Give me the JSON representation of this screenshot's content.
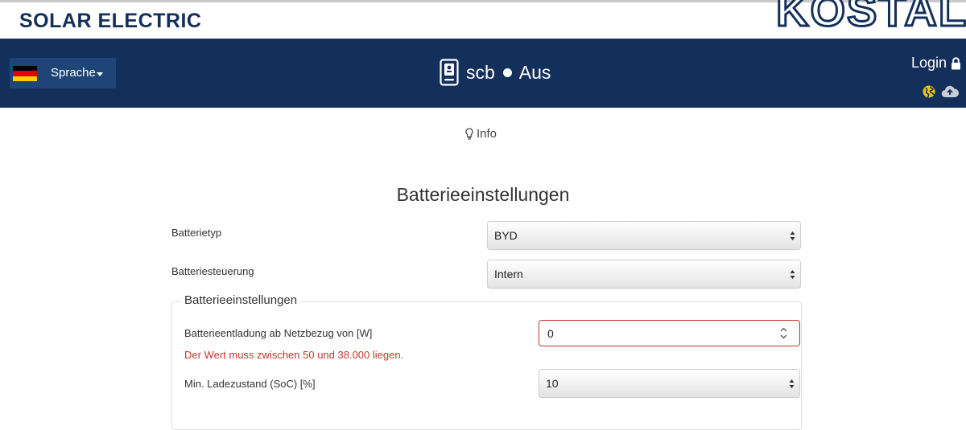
{
  "brand": {
    "title": "SOLAR ELECTRIC",
    "logo_text": "KOSTAL"
  },
  "navbar": {
    "language_label": "Sprache",
    "device_name": "scb",
    "device_state": "Aus",
    "login_label": "Login"
  },
  "info": {
    "label": "Info"
  },
  "page": {
    "title": "Batterieeinstellungen"
  },
  "form": {
    "battery_type": {
      "label": "Batterietyp",
      "value": "BYD"
    },
    "battery_control": {
      "label": "Batteriesteuerung",
      "value": "Intern"
    },
    "group": {
      "legend": "Batterieeinstellungen",
      "discharge": {
        "label": "Batterieentladung ab Netzbezug von [W]",
        "value": "0",
        "error": "Der Wert muss zwischen 50 und 38.000 liegen."
      },
      "min_soc": {
        "label": "Min. Ladezustand (SoC) [%]",
        "value": "10"
      }
    }
  },
  "colors": {
    "navbar": "#13305c",
    "brand_text": "#14305a",
    "error": "#c0392b",
    "globe_accent": "#f0c800"
  },
  "icons": [
    "flag-germany-icon",
    "caret-down-icon",
    "inverter-device-icon",
    "lock-icon",
    "globe-icon",
    "cloud-upload-icon",
    "lightbulb-icon",
    "select-updown-icon",
    "number-spinner-icon"
  ]
}
